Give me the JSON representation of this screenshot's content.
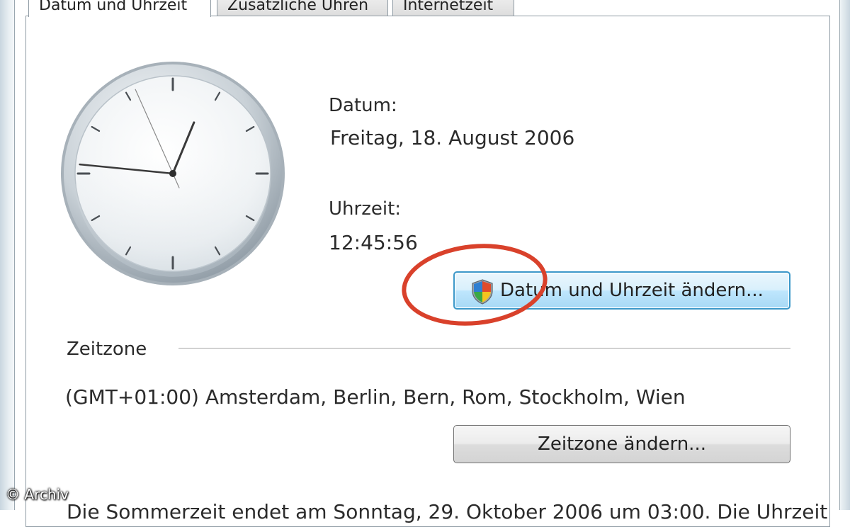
{
  "tabs": [
    {
      "label": "Datum und Uhrzeit",
      "active": true
    },
    {
      "label": "Zusätzliche Uhren",
      "active": false
    },
    {
      "label": "Internetzeit",
      "active": false
    }
  ],
  "datetime": {
    "date_label": "Datum:",
    "date_value": "Freitag, 18. August 2006",
    "time_label": "Uhrzeit:",
    "time_value": "12:45:56",
    "change_button": "Datum und Uhrzeit ändern..."
  },
  "clock": {
    "hours": 12,
    "minutes": 45,
    "seconds": 56
  },
  "timezone": {
    "section_label": "Zeitzone",
    "value": "(GMT+01:00) Amsterdam, Berlin, Bern, Rom, Stockholm, Wien",
    "change_button": "Zeitzone ändern..."
  },
  "dst_notice": "Die Sommerzeit endet am Sonntag, 29. Oktober 2006 um 03:00. Die Uhrzeit",
  "watermark": "© Archiv",
  "colors": {
    "highlight_circle": "#d9412b",
    "focus_border": "#3c98c9"
  }
}
